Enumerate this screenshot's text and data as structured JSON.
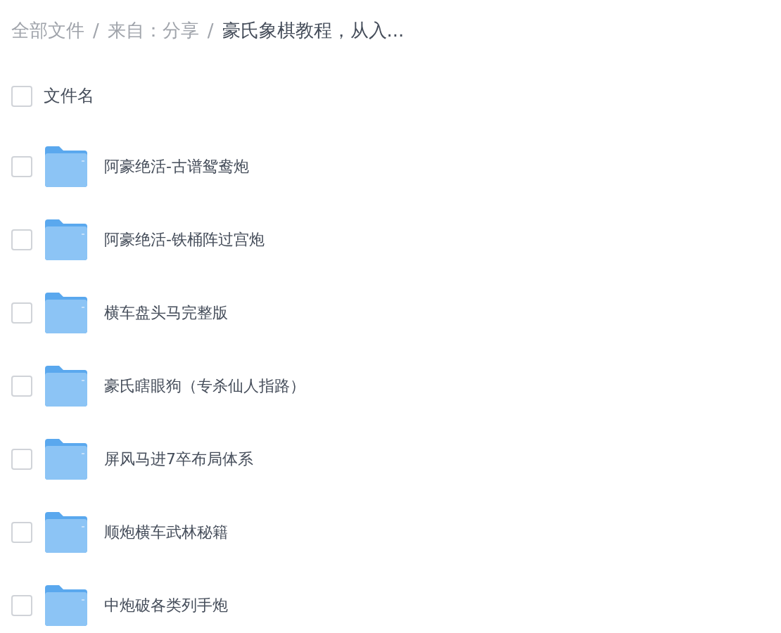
{
  "breadcrumb": {
    "separator": "/",
    "items": [
      {
        "label": "全部文件",
        "current": false
      },
      {
        "label": "来自：分享",
        "current": false
      },
      {
        "label": "豪氏象棋教程，从入...",
        "current": true
      }
    ]
  },
  "header": {
    "label": "文件名",
    "checked": false
  },
  "files": [
    {
      "name": "阿豪绝活-古谱鸳鸯炮",
      "checked": false
    },
    {
      "name": "阿豪绝活-铁桶阵过宫炮",
      "checked": false
    },
    {
      "name": "横车盘头马完整版",
      "checked": false
    },
    {
      "name": "豪氏瞎眼狗（专杀仙人指路）",
      "checked": false
    },
    {
      "name": "屏风马进7卒布局体系",
      "checked": false
    },
    {
      "name": "顺炮横车武林秘籍",
      "checked": false
    },
    {
      "name": "中炮破各类列手炮",
      "checked": false
    }
  ]
}
